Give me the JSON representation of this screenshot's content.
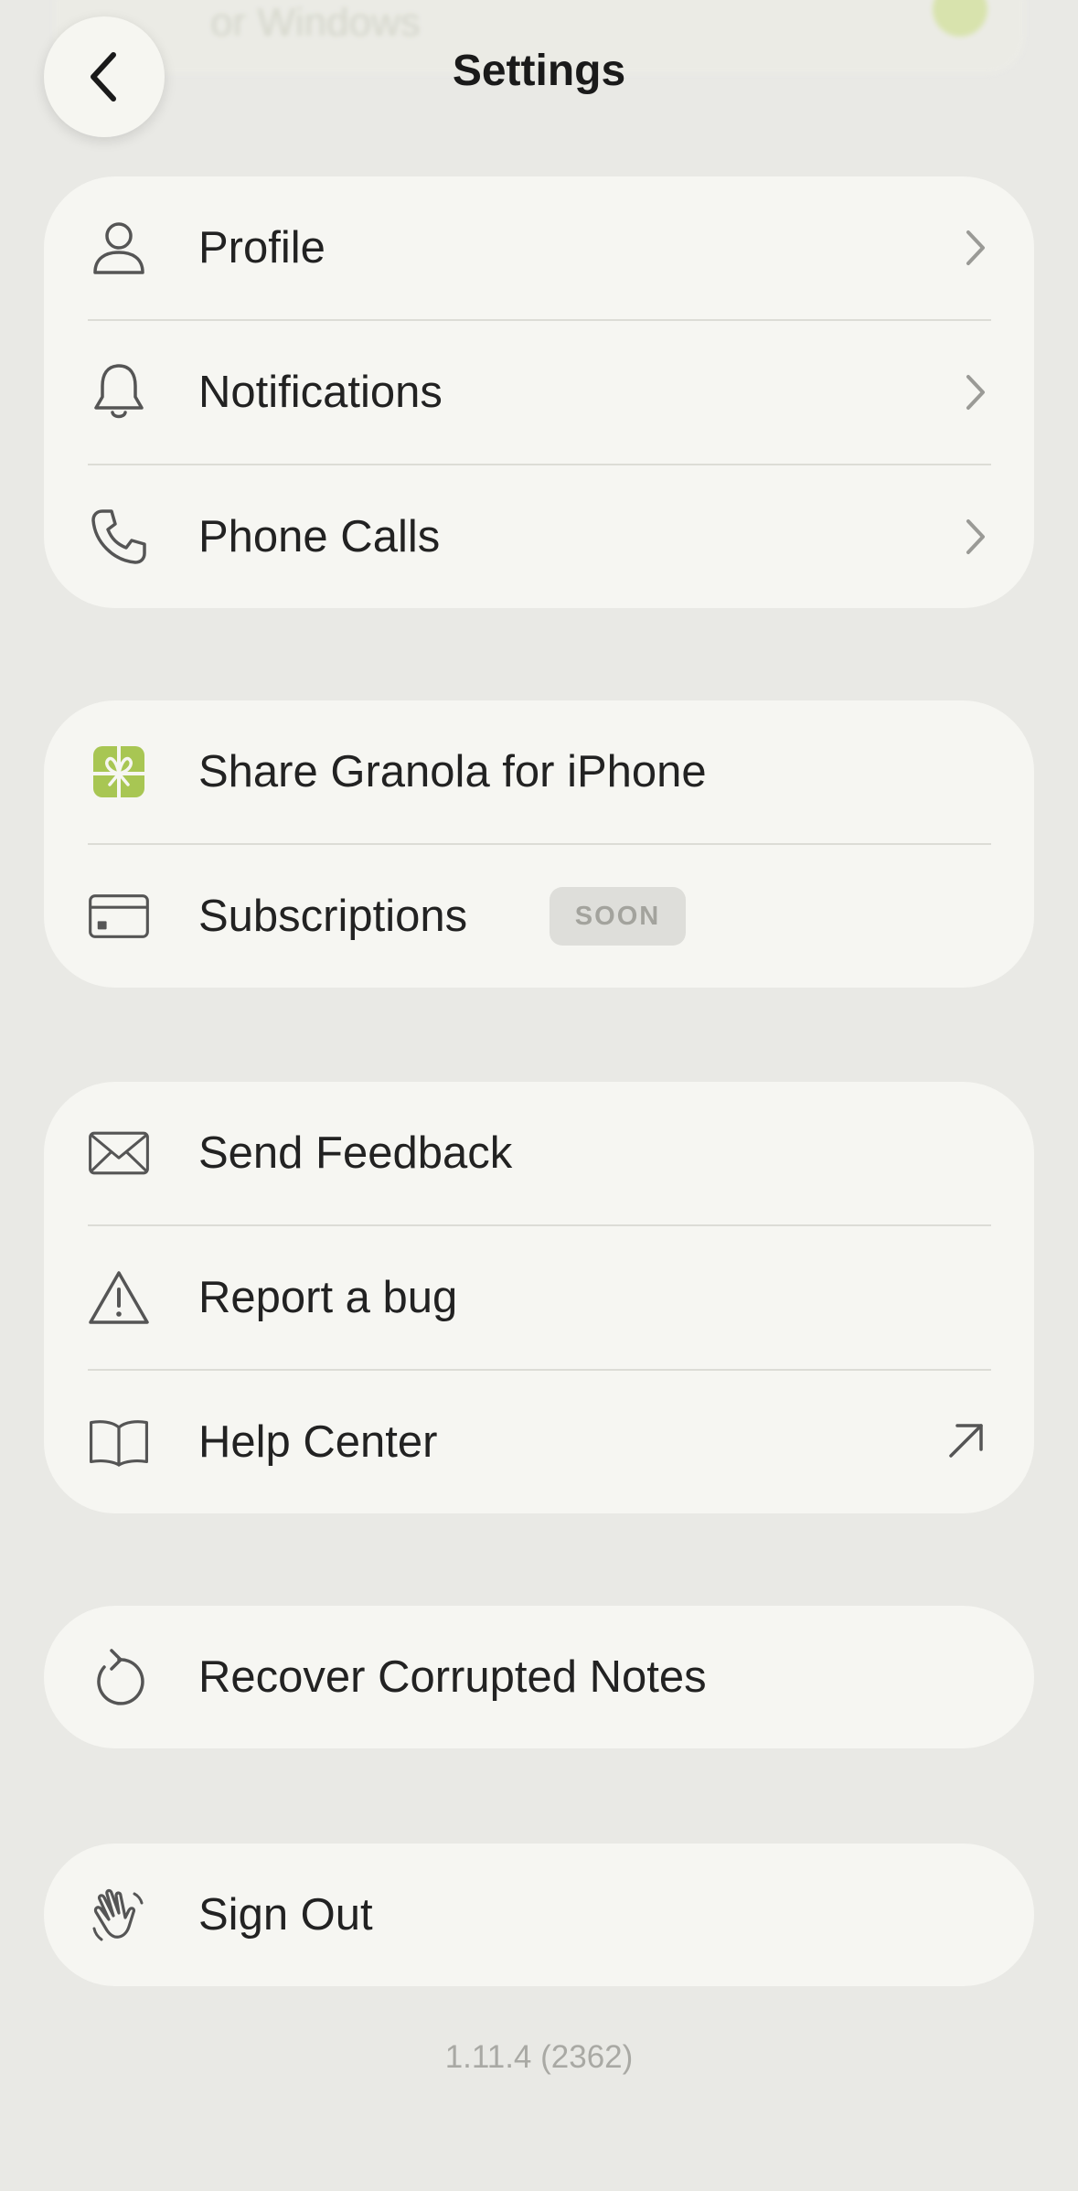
{
  "header": {
    "title": "Settings",
    "back_icon": "chevron-left-icon"
  },
  "background": {
    "ghost_text": "or Windows"
  },
  "groups": [
    {
      "items": [
        {
          "label": "Profile",
          "icon": "person-icon",
          "accessory": "chevron-right"
        },
        {
          "label": "Notifications",
          "icon": "bell-icon",
          "accessory": "chevron-right"
        },
        {
          "label": "Phone Calls",
          "icon": "phone-icon",
          "accessory": "chevron-right"
        }
      ]
    },
    {
      "items": [
        {
          "label": "Share Granola for iPhone",
          "icon": "gift-icon",
          "icon_color": "#a8c653"
        },
        {
          "label": "Subscriptions",
          "icon": "credit-card-icon",
          "badge": "SOON"
        }
      ]
    },
    {
      "items": [
        {
          "label": "Send Feedback",
          "icon": "envelope-icon"
        },
        {
          "label": "Report a bug",
          "icon": "warning-triangle-icon"
        },
        {
          "label": "Help Center",
          "icon": "book-icon",
          "accessory": "external-arrow"
        }
      ]
    },
    {
      "items": [
        {
          "label": "Recover Corrupted Notes",
          "icon": "restore-icon"
        }
      ]
    },
    {
      "items": [
        {
          "label": "Sign Out",
          "icon": "waving-hand-icon"
        }
      ]
    }
  ],
  "footer": {
    "version": "1.11.4 (2362)"
  },
  "colors": {
    "background": "#e9e9e5",
    "card": "#f6f6f2",
    "accent_green": "#a8c653",
    "badge_bg": "#dededa",
    "badge_text": "#a3a39d"
  }
}
